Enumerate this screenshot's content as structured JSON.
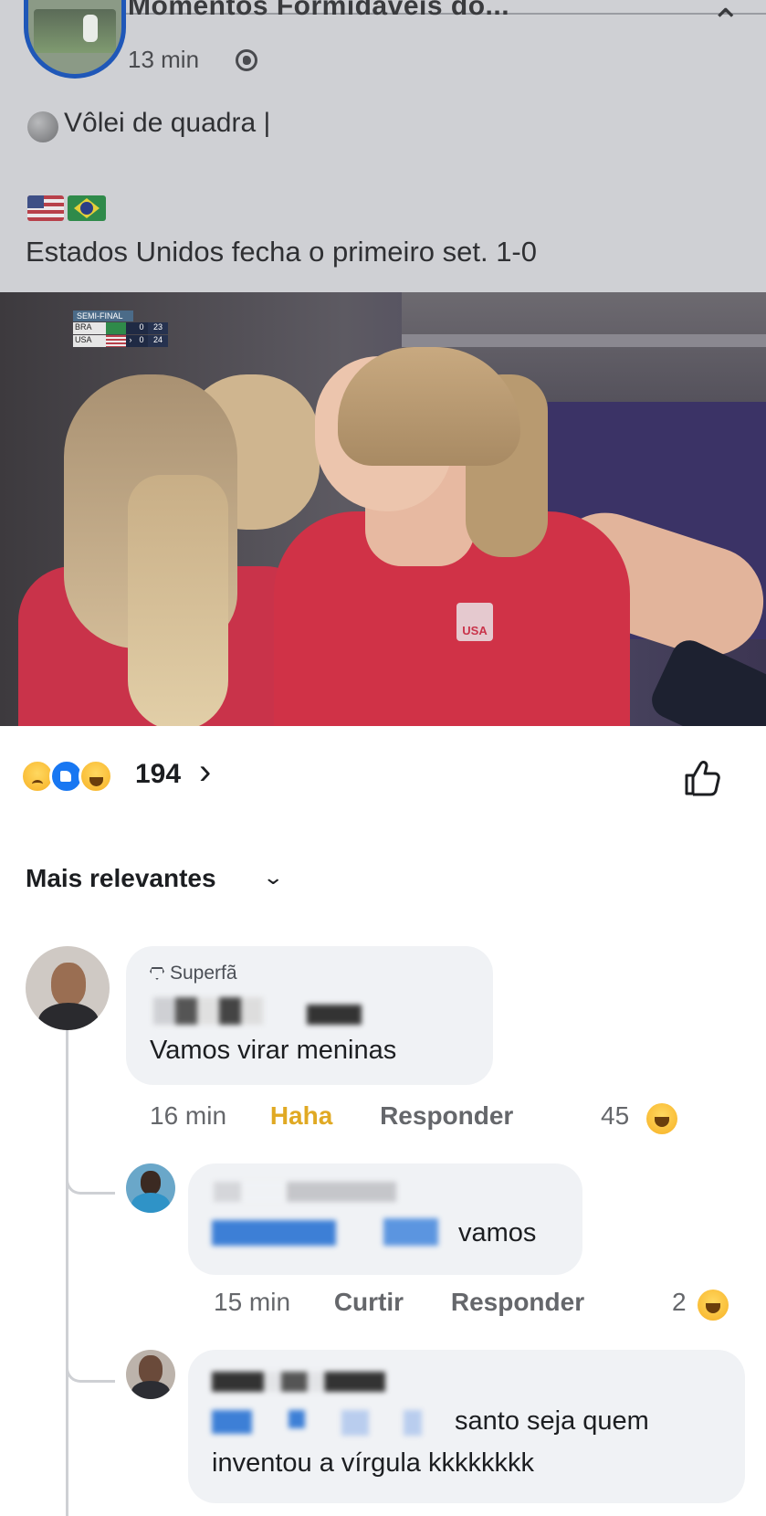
{
  "post": {
    "page_name": "Momentos Formidáveis do...",
    "time": "13 min",
    "line1": "Vôlei de quadra |",
    "line2": "Estados Unidos fecha o primeiro set. 1-0"
  },
  "scoreboard": {
    "title": "SEMI-FINAL",
    "rows": [
      {
        "team": "BRA",
        "sets": "0",
        "points": "23"
      },
      {
        "team": "USA",
        "sets": "0",
        "points": "24"
      }
    ]
  },
  "video": {
    "jersey_text": "USA"
  },
  "reactions": {
    "count": "194",
    "icons": [
      "sad-icon",
      "like-icon",
      "haha-icon"
    ]
  },
  "sort": {
    "label": "Mais relevantes"
  },
  "comments": [
    {
      "badge": "Superfã",
      "text": "Vamos virar meninas",
      "time": "16 min",
      "reaction_label": "Haha",
      "reply_label": "Responder",
      "reaction_count": "45"
    },
    {
      "text": "vamos",
      "time": "15 min",
      "like_label": "Curtir",
      "reply_label": "Responder",
      "reaction_count": "2"
    },
    {
      "text_line1": "santo seja quem",
      "text_line2": "inventou a vírgula kkkkkkkk"
    }
  ],
  "colors": {
    "brand_blue": "#1877f2",
    "haha_yellow": "#e0a923",
    "bubble_bg": "#f0f2f5"
  }
}
